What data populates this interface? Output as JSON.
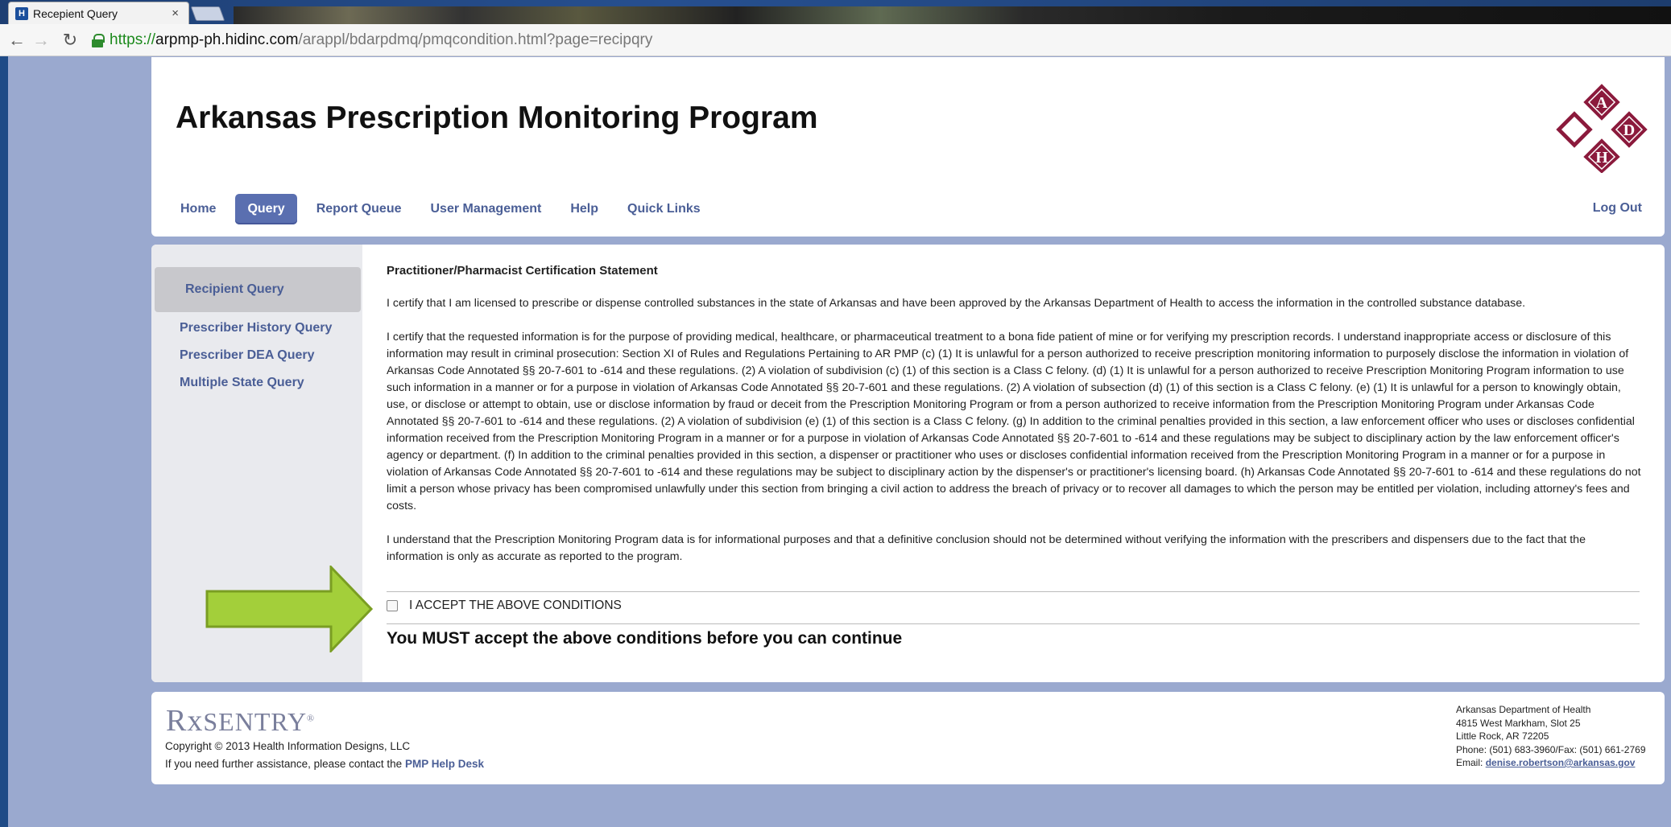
{
  "browser": {
    "tab_title": "Recepient Query",
    "favicon_letter": "H",
    "url_scheme": "https://",
    "url_host": "arpmp-ph.hidinc.com",
    "url_path": "/arappl/bdarpdmq/pmqcondition.html?page=recipqry"
  },
  "header": {
    "title": "Arkansas Prescription Monitoring Program",
    "logo_letters": [
      "A",
      "D",
      "H"
    ],
    "nav": [
      "Home",
      "Query",
      "Report Queue",
      "User Management",
      "Help",
      "Quick Links"
    ],
    "active_nav": "Query",
    "logout": "Log Out"
  },
  "sidebar": {
    "items": [
      "Recipient Query",
      "Prescriber History Query",
      "Prescriber DEA Query",
      "Multiple State Query"
    ],
    "active": "Recipient Query"
  },
  "certification": {
    "heading": "Practitioner/Pharmacist Certification Statement",
    "para1": "I certify that I am licensed to prescribe or dispense controlled substances in the state of Arkansas and have been approved by the Arkansas Department of Health to access the information in the controlled substance database.",
    "para2": "I certify that the requested information is for the purpose of providing medical, healthcare, or pharmaceutical treatment to a bona fide patient of mine or for verifying my prescription records. I understand inappropriate access or disclosure of this information may result in criminal prosecution: Section XI of Rules and Regulations Pertaining to AR PMP (c) (1) It is unlawful for a person authorized to receive prescription monitoring information to purposely disclose the information in violation of Arkansas Code Annotated §§ 20-7-601 to -614 and these regulations. (2) A violation of subdivision (c) (1) of this section is a Class C felony. (d) (1) It is unlawful for a person authorized to receive Prescription Monitoring Program information to use such information in a manner or for a purpose in violation of Arkansas Code Annotated §§ 20-7-601 and these regulations. (2) A violation of subsection (d) (1) of this section is a Class C felony. (e) (1) It is unlawful for a person to knowingly obtain, use, or disclose or attempt to obtain, use or disclose information by fraud or deceit from the Prescription Monitoring Program or from a person authorized to receive information from the Prescription Monitoring Program under Arkansas Code Annotated §§ 20-7-601 to -614 and these regulations. (2) A violation of subdivision (e) (1) of this section is a Class C felony. (g) In addition to the criminal penalties provided in this section, a law enforcement officer who uses or discloses confidential information received from the Prescription Monitoring Program in a manner or for a purpose in violation of Arkansas Code Annotated §§ 20-7-601 to -614 and these regulations may be subject to disciplinary action by the law enforcement officer's agency or department. (f) In addition to the criminal penalties provided in this section, a dispenser or practitioner who uses or discloses confidential information received from the Prescription Monitoring Program in a manner or for a purpose in violation of Arkansas Code Annotated §§ 20-7-601 to -614 and these regulations may be subject to disciplinary action by the dispenser's or practitioner's licensing board. (h) Arkansas Code Annotated §§ 20-7-601 to -614 and these regulations do not limit a person whose privacy has been compromised unlawfully under this section from bringing a civil action to address the breach of privacy or to recover all damages to which the person may be entitled per violation, including attorney's fees and costs.",
    "para3": "I understand that the Prescription Monitoring Program data is for informational purposes and that a definitive conclusion should not be determined without verifying the information with the prescribers and dispensers due to the fact that the information is only as accurate as reported to the program.",
    "accept_label": "I ACCEPT THE ABOVE CONDITIONS",
    "accept_checked": false,
    "must_accept": "You MUST accept the above conditions before you can continue"
  },
  "footer": {
    "brand": "SENTRY",
    "brand_prefix": "Rx",
    "copyright": "Copyright © 2013 Health Information Designs, LLC",
    "help_text": "If you need further assistance, please contact the ",
    "help_link": "PMP Help Desk",
    "address_lines": [
      "Arkansas Department of Health",
      "4815 West Markham, Slot 25",
      "Little Rock, AR 72205",
      "Phone: (501) 683-3960/Fax: (501) 661-2769"
    ],
    "email_label": "Email: ",
    "email": "denise.robertson@arkansas.gov"
  },
  "colors": {
    "page_bg": "#9aa9cf",
    "nav_link": "#4a5e96",
    "active_nav_bg": "#5a6fb0",
    "logo_maroon": "#8b1a3c",
    "arrow_green": "#a3cf3a"
  }
}
